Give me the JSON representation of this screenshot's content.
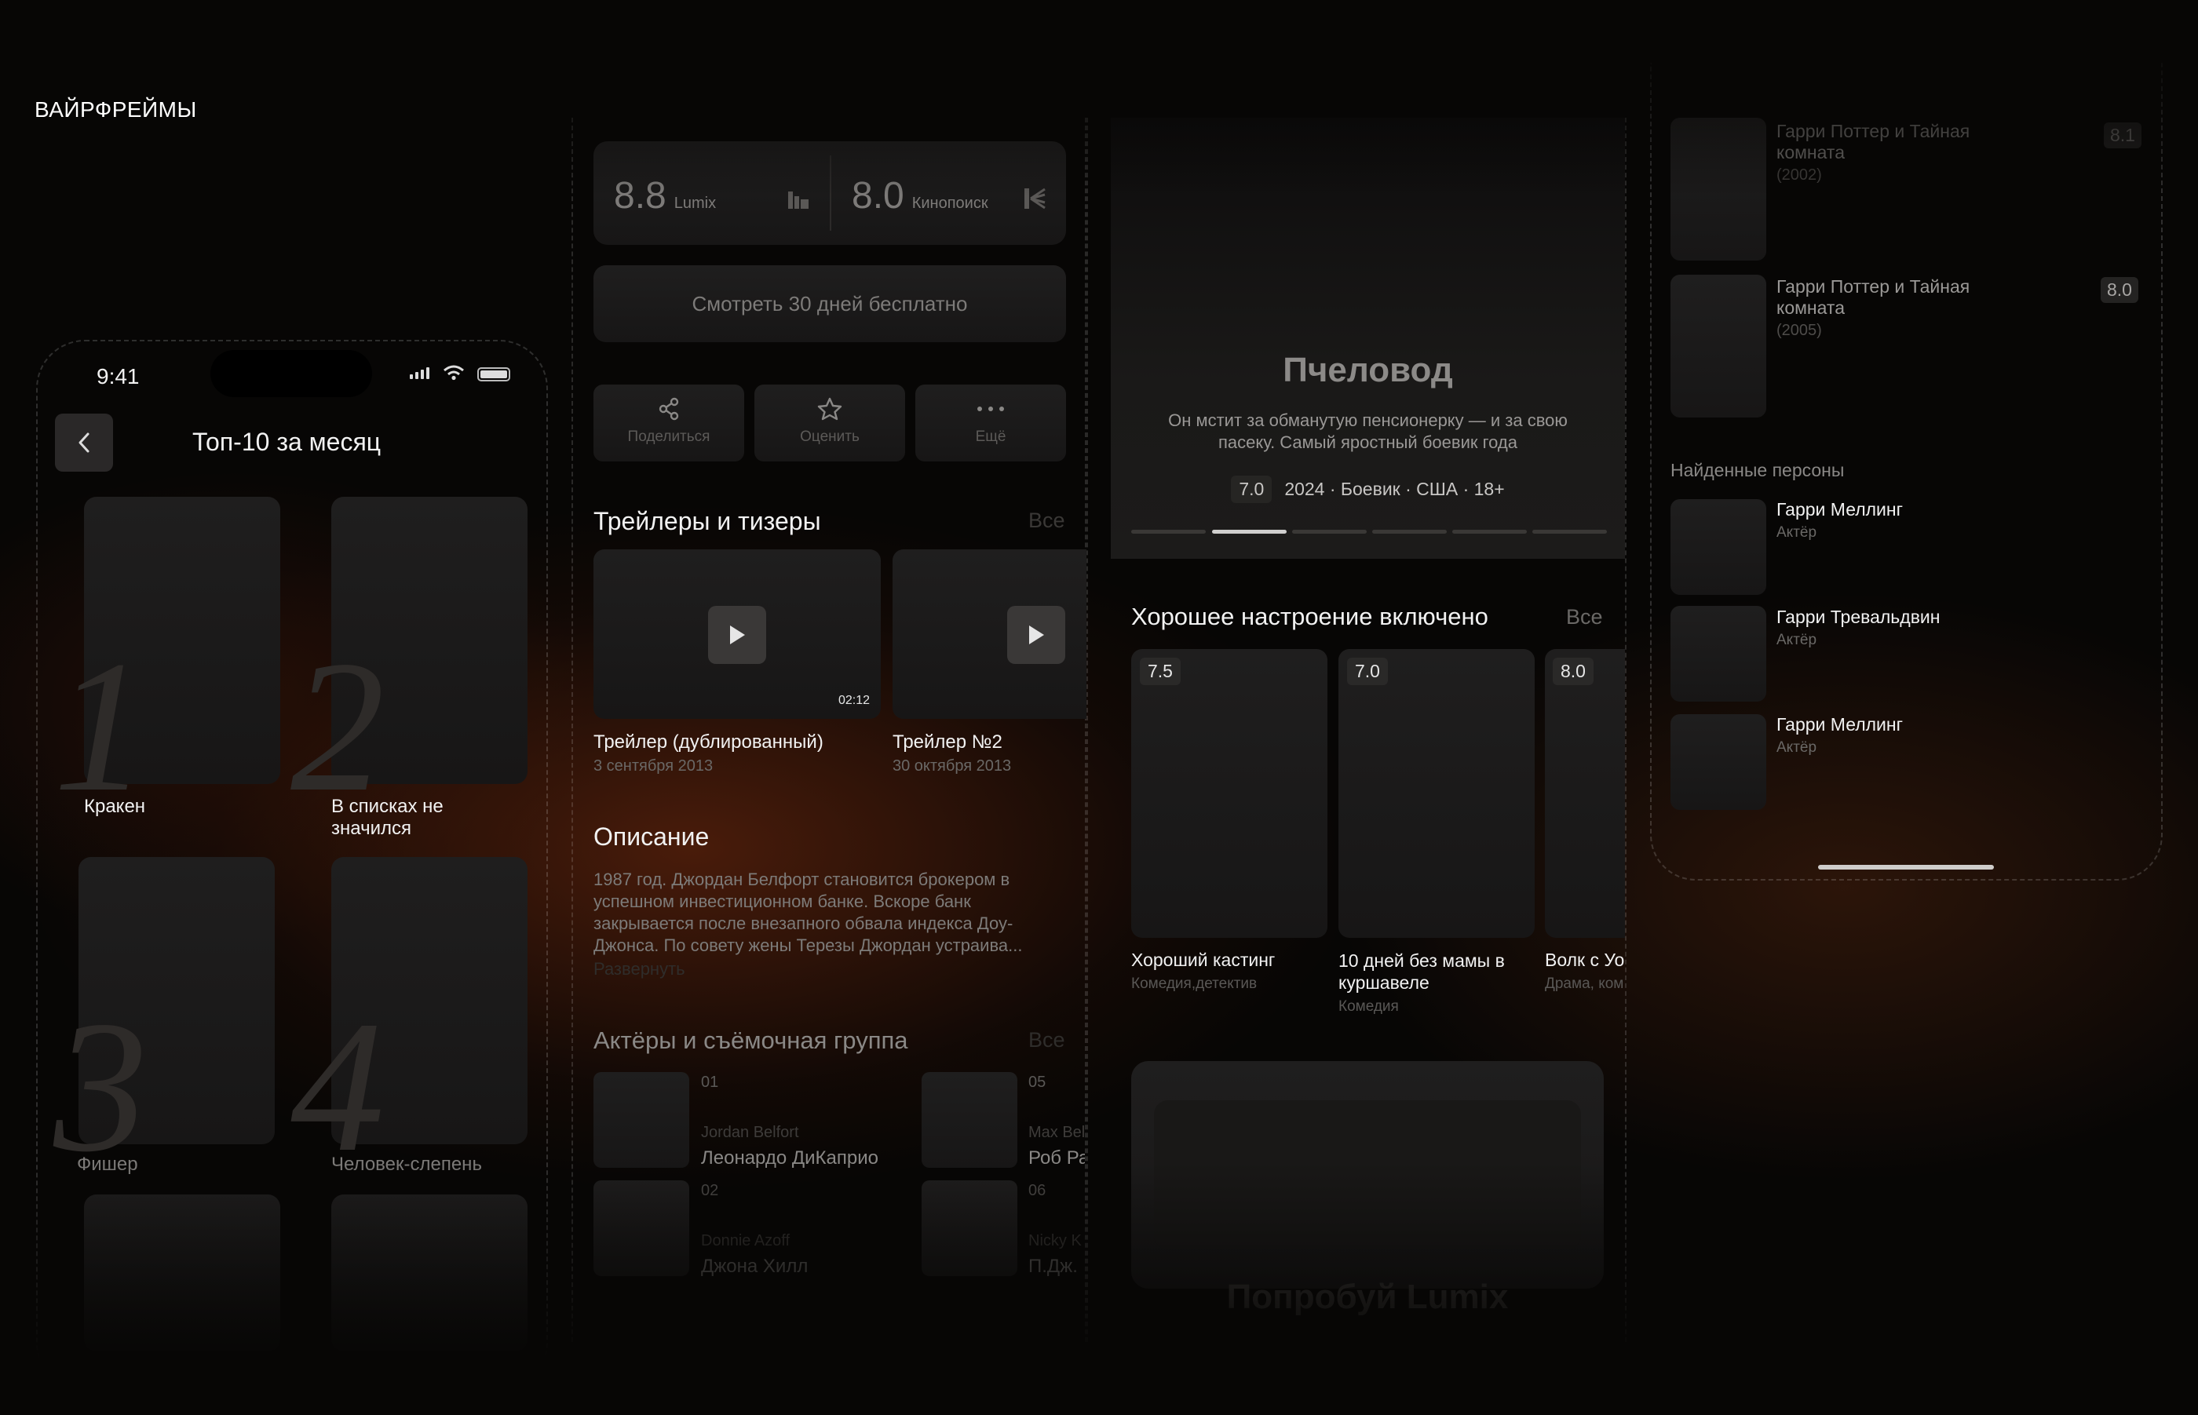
{
  "header": {
    "title": "ВАЙРФРЕЙМЫ"
  },
  "screen1": {
    "status_time": "9:41",
    "title": "Топ-10 за месяц",
    "items": [
      {
        "rank": "1",
        "label": "Кракен"
      },
      {
        "rank": "2",
        "label": "В списках не значился"
      },
      {
        "rank": "3",
        "label": "Фишер"
      },
      {
        "rank": "4",
        "label": "Человек-слепень"
      }
    ]
  },
  "screen2": {
    "ratings": [
      {
        "value": "8.8",
        "source": "Lumix"
      },
      {
        "value": "8.0",
        "source": "Кинопоиск"
      }
    ],
    "watch_button": "Смотреть 30 дней бесплатно",
    "actions": {
      "share": "Поделиться",
      "rate": "Оценить",
      "more": "Ещё"
    },
    "trailers": {
      "heading": "Трейлеры и тизеры",
      "all": "Все",
      "items": [
        {
          "title": "Трейлер (дублированный)",
          "date": "3 сентября 2013",
          "duration": "02:12"
        },
        {
          "title": "Трейлер №2",
          "date": "30 октября 2013"
        }
      ]
    },
    "description": {
      "heading": "Описание",
      "text": "1987 год. Джордан Белфорт становится брокером в успешном инвестиционном банке. Вскоре банк закрывается после внезапного обвала индекса Доу-Джонса. По совету жены Терезы Джордан устраива...",
      "expand": "Развернуть"
    },
    "cast": {
      "heading": "Актёры и съёмочная группа",
      "all": "Все",
      "items": [
        {
          "num": "01",
          "role": "Jordan Belfort",
          "name": "Леонардо ДиКаприо"
        },
        {
          "num": "05",
          "role": "Max Bel",
          "name": "Роб Ра"
        },
        {
          "num": "02",
          "role": "Donnie Azoff",
          "name": "Джона Хилл"
        },
        {
          "num": "06",
          "role": "Nicky K",
          "name": "П.Дж."
        }
      ]
    }
  },
  "screen3": {
    "hero": {
      "title": "Пчеловод",
      "description": "Он мстит за обманутую пенсионерку — и за свою пасеку. Самый яростный боевик года",
      "rating": "7.0",
      "meta": "2024 · Боевик · США · 18+"
    },
    "section": {
      "heading": "Хорошее настроение включено",
      "all": "Все",
      "items": [
        {
          "rating": "7.5",
          "title": "Хороший кастинг",
          "genre": "Комедия,детектив"
        },
        {
          "rating": "7.0",
          "title": "10 дней без мамы в куршавеле",
          "genre": "Комедия"
        },
        {
          "rating": "8.0",
          "title": "Волк с Уо",
          "genre": "Драма, ком"
        }
      ]
    },
    "promo": "Попробуй Lumix"
  },
  "screen4": {
    "movies": [
      {
        "title": "Гарри Поттер и Тайная комната",
        "year": "(2002)",
        "rating": "8.1"
      },
      {
        "title": "Гарри Поттер и Тайная комната",
        "year": "(2005)",
        "rating": "8.0"
      }
    ],
    "persons_heading": "Найденные персоны",
    "persons": [
      {
        "name": "Гарри Меллинг",
        "role": "Актёр"
      },
      {
        "name": "Гарри Тревальдвин",
        "role": "Актёр"
      },
      {
        "name": "Гарри Меллинг",
        "role": "Актёр"
      }
    ]
  }
}
